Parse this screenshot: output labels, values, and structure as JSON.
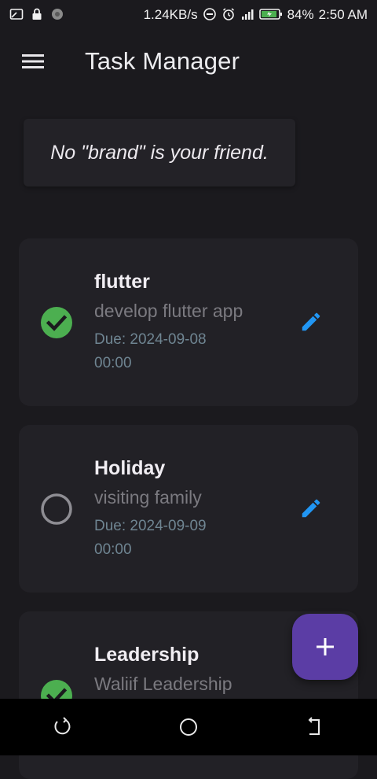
{
  "status_bar": {
    "speed": "1.24KB/s",
    "battery": "84%",
    "time": "2:50 AM"
  },
  "app_bar": {
    "title": "Task Manager"
  },
  "quote": {
    "text": "No \"brand\" is your friend."
  },
  "tasks": [
    {
      "title": "flutter",
      "description": "develop flutter app",
      "due": "Due: 2024-09-08 00:00",
      "completed": true
    },
    {
      "title": "Holiday",
      "description": "visiting family",
      "due": "Due: 2024-09-09 00:00",
      "completed": false
    },
    {
      "title": "Leadership",
      "description": "Waliif Leadership",
      "completed": true
    }
  ],
  "colors": {
    "background": "#1b1a1e",
    "card": "#222126",
    "check_green": "#4caf50",
    "edit_blue": "#2196f3",
    "fab": "#5b3da5"
  },
  "icons": {
    "menu": "hamburger-menu",
    "edit": "pencil",
    "add": "plus",
    "done": "check-circle",
    "pending": "empty-circle"
  }
}
